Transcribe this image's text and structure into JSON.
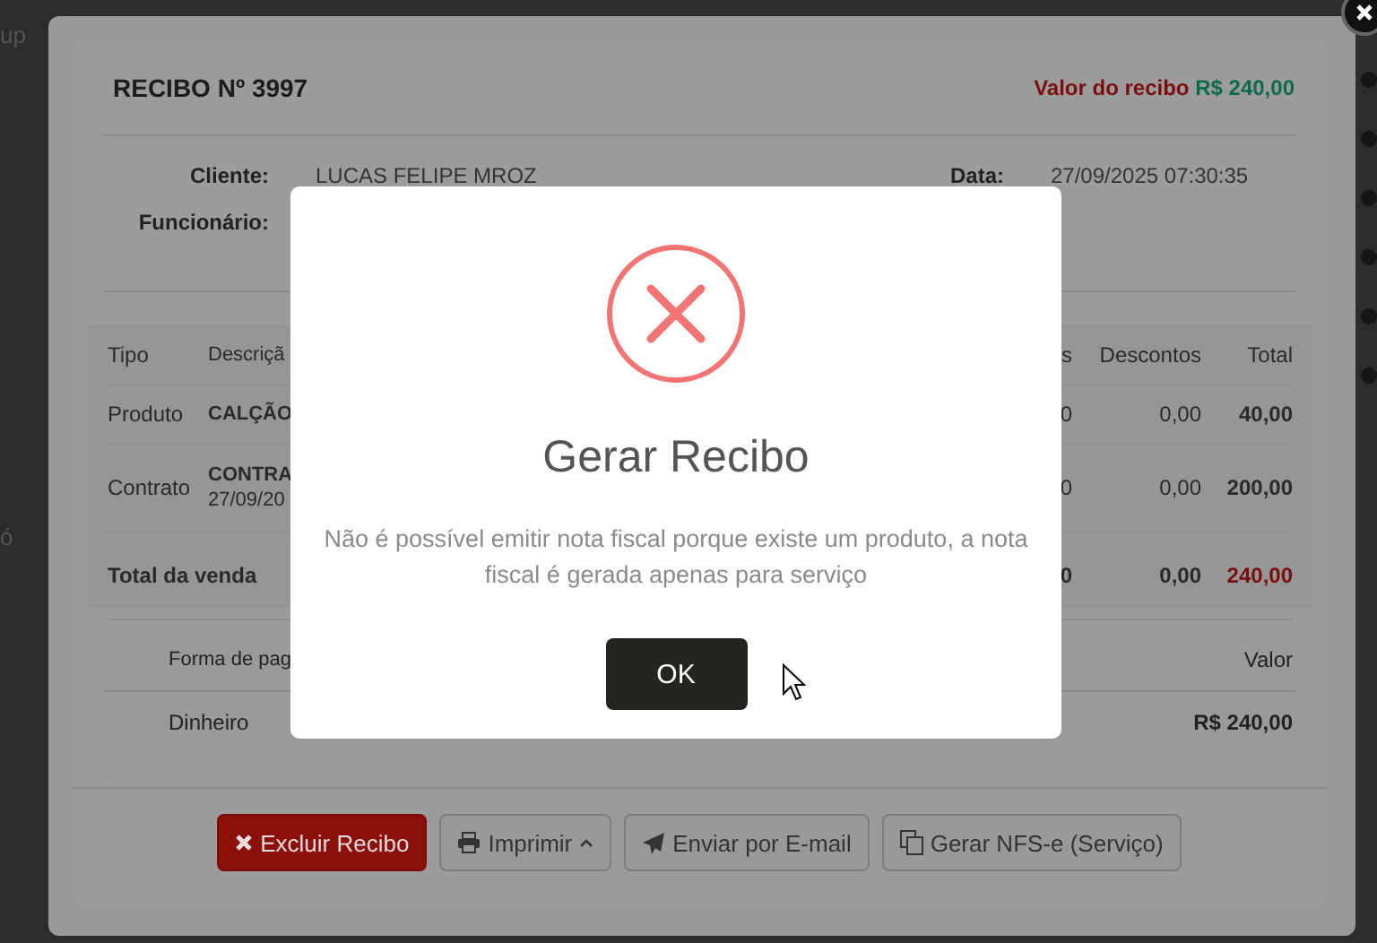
{
  "background": {
    "fragments": [
      "up",
      "ó"
    ]
  },
  "receipt": {
    "title": "RECIBO Nº 3997",
    "value_label": "Valor do recibo",
    "value_amount": "R$ 240,00",
    "info": [
      {
        "label": "Cliente:",
        "value": "LUCAS FELIPE MROZ"
      },
      {
        "label": "Data:",
        "value": "27/09/2025 07:30:35"
      },
      {
        "label": "Funcionário:"
      }
    ]
  },
  "items": {
    "columns": [
      "Tipo",
      "Descriçã",
      "s",
      "Descontos",
      "Total"
    ],
    "rows": [
      {
        "kind": "item",
        "type": "Produto",
        "description": "CALÇÃO",
        "column_3": "0",
        "discount": "0,00",
        "total": "40,00"
      },
      {
        "kind": "item",
        "type": "Contrato",
        "description": "CONTRA",
        "detail": "27/09/20",
        "column_3": "0",
        "discount": "0,00",
        "total": "200,00"
      },
      {
        "kind": "total",
        "type": "Total da venda",
        "column_3": "0",
        "discount": "0,00",
        "total": "240,00"
      }
    ]
  },
  "payments": {
    "columns": [
      "Forma de pag",
      "Valor"
    ],
    "rows": [
      {
        "method": "Dinheiro",
        "amount": "R$ 240,00"
      }
    ]
  },
  "buttons": [
    {
      "kind": "danger",
      "label": "Excluir Recibo"
    },
    {
      "kind": "default",
      "label": "Imprimir",
      "caret": true
    },
    {
      "kind": "default",
      "label": "Enviar por E-mail"
    },
    {
      "kind": "default",
      "label": "Gerar NFS-e (Serviço)"
    }
  ],
  "alert": {
    "kind": "error",
    "title": "Gerar Recibo",
    "message": "Não é possível emitir nota fiscal porque existe um produto, a nota fiscal é gerada apenas para serviço",
    "button": "OK"
  }
}
